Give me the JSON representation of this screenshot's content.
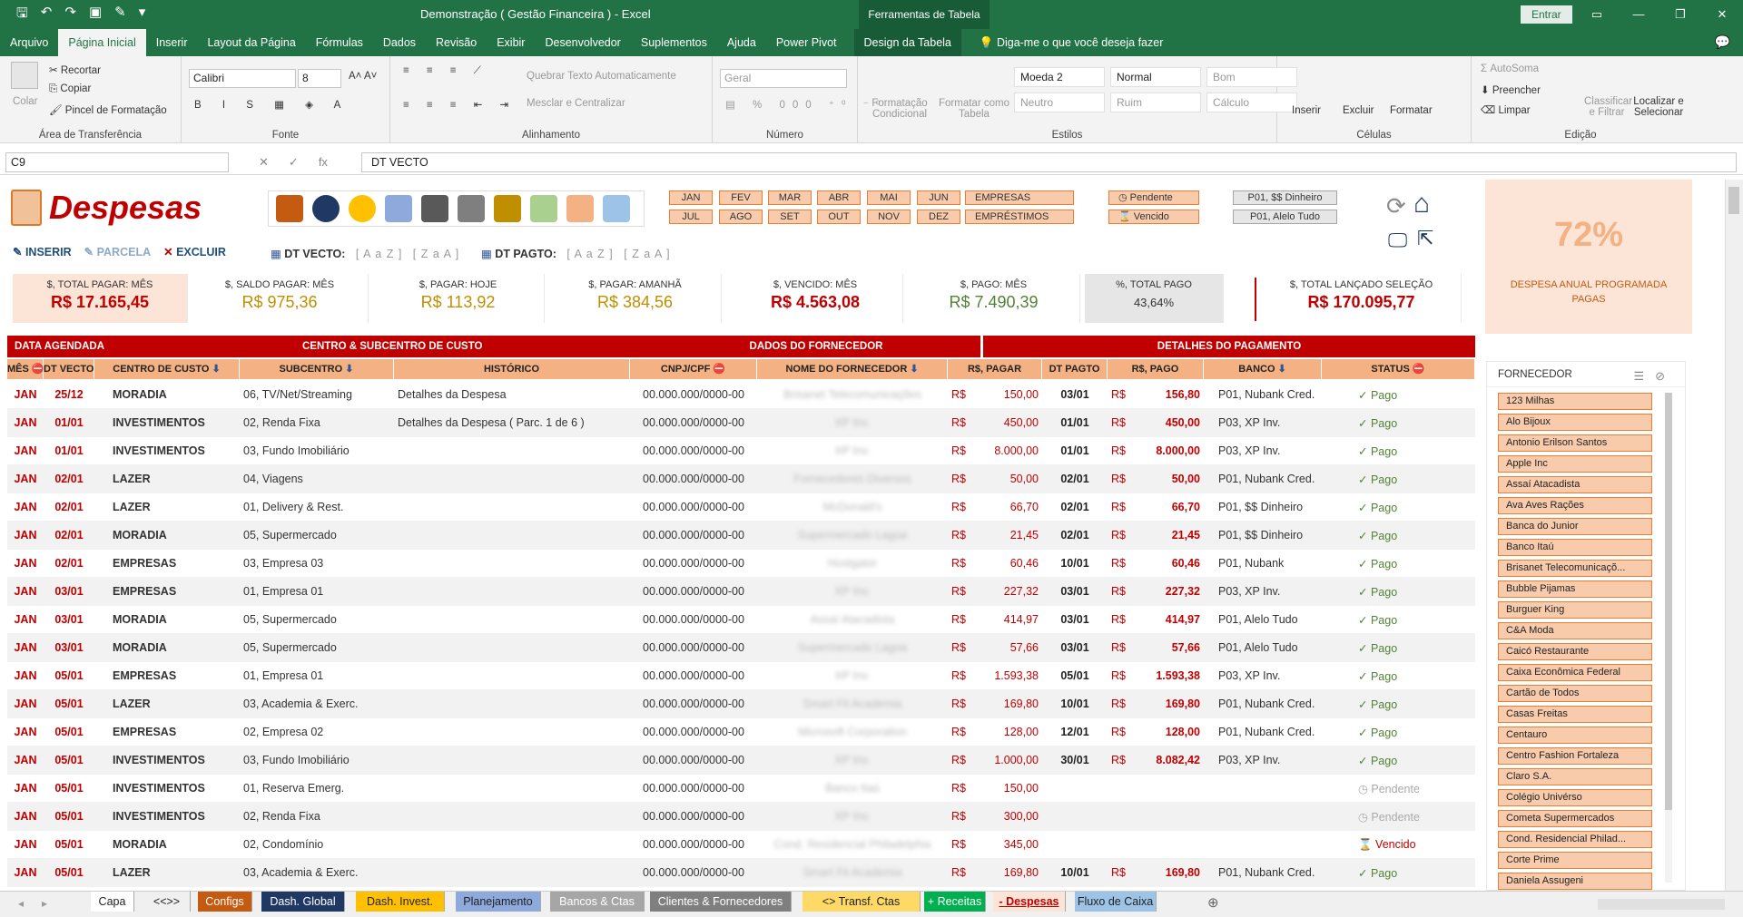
{
  "window": {
    "title": "Demonstração ( Gestão Financeira ) - Excel",
    "contextual": "Ferramentas de Tabela",
    "signin": "Entrar"
  },
  "ribbon_tabs": [
    "Arquivo",
    "Página Inicial",
    "Inserir",
    "Layout da Página",
    "Fórmulas",
    "Dados",
    "Revisão",
    "Exibir",
    "Desenvolvedor",
    "Suplementos",
    "Ajuda",
    "Power Pivot",
    "Design da Tabela"
  ],
  "tell_me": "Diga-me o que você deseja fazer",
  "ribbon": {
    "clipboard": {
      "paste": "Colar",
      "cut": "Recortar",
      "copy": "Copiar",
      "painter": "Pincel de Formatação",
      "label": "Área de Transferência"
    },
    "font": {
      "name": "Calibri",
      "size": "8",
      "label": "Fonte"
    },
    "alignment": {
      "wrap": "Quebrar Texto Automaticamente",
      "merge": "Mesclar e Centralizar",
      "label": "Alinhamento"
    },
    "number": {
      "format": "Geral",
      "label": "Número"
    },
    "styles": {
      "cond": "Formatação Condicional",
      "table": "Formatar como Tabela",
      "s1": "Moeda 2",
      "s2": "Normal",
      "s3": "Bom",
      "s4": "Neutro",
      "s5": "Ruim",
      "s6": "Cálculo",
      "label": "Estilos"
    },
    "cells": {
      "insert": "Inserir",
      "delete": "Excluir",
      "format": "Formatar",
      "label": "Células"
    },
    "editing": {
      "autosum": "AutoSoma",
      "fill": "Preencher",
      "clear": "Limpar",
      "sort": "Classificar e Filtrar",
      "find": "Localizar e Selecionar",
      "label": "Edição"
    }
  },
  "formula": {
    "cell": "C9",
    "content": "DT VECTO"
  },
  "sheet": {
    "title": "Despesas",
    "actions": {
      "insert": "INSERIR",
      "parcel": "PARCELA",
      "delete": "EXCLUIR"
    },
    "sort1": {
      "label": "DT VECTO:",
      "az": "[ A a Z ]",
      "za": "[ Z a A ]"
    },
    "sort2": {
      "label": "DT PAGTO:",
      "az": "[ A a Z ]",
      "za": "[ Z a A ]"
    },
    "months_top": [
      "JAN",
      "FEV",
      "MAR",
      "ABR",
      "MAI",
      "JUN"
    ],
    "months_bottom": [
      "JUL",
      "AGO",
      "SET",
      "OUT",
      "NOV",
      "DEZ"
    ],
    "wide_btns": [
      "EMPRESAS",
      "EMPRÉSTIMOS"
    ],
    "status_btns": [
      "Pendente",
      "Vencido"
    ],
    "bank_btns": [
      "P01, $$ Dinheiro",
      "P01, Alelo Tudo"
    ],
    "kpis": [
      {
        "label": "$, TOTAL PAGAR: MÊS",
        "value": "R$ 17.165,45"
      },
      {
        "label": "$, SALDO PAGAR: MÊS",
        "value": "R$ 975,36"
      },
      {
        "label": "$, PAGAR: HOJE",
        "value": "R$ 113,92"
      },
      {
        "label": "$, PAGAR: AMANHÃ",
        "value": "R$ 384,56"
      },
      {
        "label": "$, VENCIDO: MÊS",
        "value": "R$ 4.563,08"
      },
      {
        "label": "$, PAGO: MÊS",
        "value": "R$ 7.490,39"
      },
      {
        "label": "%, TOTAL PAGO",
        "value": "43,64%"
      },
      {
        "label": "$, TOTAL LANÇADO SELEÇÃO",
        "value": "R$ 170.095,77"
      }
    ],
    "side": {
      "pct": "72%",
      "caption1": "DESPESA ANUAL PROGRAMADA",
      "caption2": "PAGAS"
    },
    "sections": [
      "DATA AGENDADA",
      "CENTRO & SUBCENTRO DE CUSTO",
      "DADOS DO FORNECEDOR",
      "DETALHES DO PAGAMENTO"
    ],
    "columns": [
      "MÊS",
      "DT VECTO",
      "CENTRO DE CUSTO",
      "SUBCENTRO",
      "HISTÓRICO",
      "CNPJ/CPF",
      "NOME DO FORNECEDOR",
      "R$, PAGAR",
      "DT PAGTO",
      "R$, PAGO",
      "BANCO",
      "STATUS"
    ],
    "rows": [
      [
        "JAN",
        "25/12",
        "MORADIA",
        "06, TV/Net/Streaming",
        "Detalhes da Despesa",
        "00.000.000/0000-00",
        "Brisanet Telecomunicações",
        "150,00",
        "03/01",
        "156,80",
        "P01, Nubank Cred.",
        "✓ Pago"
      ],
      [
        "JAN",
        "01/01",
        "INVESTIMENTOS",
        "02, Renda Fixa",
        "Detalhes da Despesa ( Parc. 1 de 6 )",
        "00.000.000/0000-00",
        "XP Inv.",
        "450,00",
        "01/01",
        "450,00",
        "P03, XP Inv.",
        "✓ Pago"
      ],
      [
        "JAN",
        "01/01",
        "INVESTIMENTOS",
        "03, Fundo Imobiliário",
        "",
        "00.000.000/0000-00",
        "XP Inv.",
        "8.000,00",
        "01/01",
        "8.000,00",
        "P03, XP Inv.",
        "✓ Pago"
      ],
      [
        "JAN",
        "02/01",
        "LAZER",
        "04, Viagens",
        "",
        "00.000.000/0000-00",
        "Fornecedores Diversos",
        "50,00",
        "02/01",
        "50,00",
        "P01, Nubank Cred.",
        "✓ Pago"
      ],
      [
        "JAN",
        "02/01",
        "LAZER",
        "01, Delivery & Rest.",
        "",
        "00.000.000/0000-00",
        "McDonald's",
        "66,70",
        "02/01",
        "66,70",
        "P01, $$ Dinheiro",
        "✓ Pago"
      ],
      [
        "JAN",
        "02/01",
        "MORADIA",
        "05, Supermercado",
        "",
        "00.000.000/0000-00",
        "Supermercado Lagoa",
        "21,45",
        "02/01",
        "21,45",
        "P01, $$ Dinheiro",
        "✓ Pago"
      ],
      [
        "JAN",
        "02/01",
        "EMPRESAS",
        "03, Empresa 03",
        "",
        "00.000.000/0000-00",
        "Hostgator",
        "60,46",
        "10/01",
        "60,46",
        "P01, Nubank",
        "✓ Pago"
      ],
      [
        "JAN",
        "03/01",
        "EMPRESAS",
        "01, Empresa 01",
        "",
        "00.000.000/0000-00",
        "XP Inv.",
        "227,32",
        "03/01",
        "227,32",
        "P03, XP Inv.",
        "✓ Pago"
      ],
      [
        "JAN",
        "03/01",
        "MORADIA",
        "05, Supermercado",
        "",
        "00.000.000/0000-00",
        "Assaí Atacadista",
        "414,97",
        "03/01",
        "414,97",
        "P01, Alelo Tudo",
        "✓ Pago"
      ],
      [
        "JAN",
        "03/01",
        "MORADIA",
        "05, Supermercado",
        "",
        "00.000.000/0000-00",
        "Supermercado Lagoa",
        "57,66",
        "03/01",
        "57,66",
        "P01, Alelo Tudo",
        "✓ Pago"
      ],
      [
        "JAN",
        "05/01",
        "EMPRESAS",
        "01, Empresa 01",
        "",
        "00.000.000/0000-00",
        "XP Inv.",
        "1.593,38",
        "05/01",
        "1.593,38",
        "P03, XP Inv.",
        "✓ Pago"
      ],
      [
        "JAN",
        "05/01",
        "LAZER",
        "03, Academia & Exerc.",
        "",
        "00.000.000/0000-00",
        "Smart Fit Academia",
        "169,80",
        "10/01",
        "169,80",
        "P01, Nubank Cred.",
        "✓ Pago"
      ],
      [
        "JAN",
        "05/01",
        "EMPRESAS",
        "02, Empresa 02",
        "",
        "00.000.000/0000-00",
        "Microsoft Corporation",
        "128,00",
        "12/01",
        "128,00",
        "P01, Nubank Cred.",
        "✓ Pago"
      ],
      [
        "JAN",
        "05/01",
        "INVESTIMENTOS",
        "03, Fundo Imobiliário",
        "",
        "00.000.000/0000-00",
        "XP Inv.",
        "1.000,00",
        "30/01",
        "8.082,42",
        "P03, XP Inv.",
        "✓ Pago"
      ],
      [
        "JAN",
        "05/01",
        "INVESTIMENTOS",
        "01, Reserva Emerg.",
        "",
        "00.000.000/0000-00",
        "Banco Itaú",
        "150,00",
        "",
        "",
        "",
        "Pendente"
      ],
      [
        "JAN",
        "05/01",
        "INVESTIMENTOS",
        "02, Renda Fixa",
        "",
        "00.000.000/0000-00",
        "XP Inv.",
        "300,00",
        "",
        "",
        "",
        "Pendente"
      ],
      [
        "JAN",
        "05/01",
        "MORADIA",
        "02, Condomínio",
        "",
        "00.000.000/0000-00",
        "Cond. Residencial Philadelphia",
        "345,00",
        "",
        "",
        "",
        "Vencido"
      ],
      [
        "JAN",
        "05/01",
        "LAZER",
        "03, Academia & Exerc.",
        "",
        "00.000.000/0000-00",
        "Smart Fit Academia",
        "169,80",
        "10/01",
        "169,80",
        "P01, Nubank Cred.",
        "✓ Pago"
      ]
    ],
    "currency": "R$",
    "fornecedor": {
      "title": "FORNECEDOR",
      "items": [
        "123 Milhas",
        "Alo Bijoux",
        "Antonio Erilson Santos",
        "Apple Inc",
        "Assaí Atacadista",
        "Ava Aves Rações",
        "Banca do Junior",
        "Banco Itaú",
        "Brisanet Telecomunicaçõ...",
        "Bubble Pijamas",
        "Burguer King",
        "C&A Moda",
        "Caicó Restaurante",
        "Caixa Econômica Federal",
        "Cartão de Todos",
        "Casas Freitas",
        "Centauro",
        "Centro Fashion Fortaleza",
        "Claro S.A.",
        "Colégio Univérso",
        "Cometa Supermercados",
        "Cond. Residencial Philad...",
        "Corte Prime",
        "Daniela Assugeni"
      ]
    }
  },
  "sheet_tabs": [
    {
      "name": "Capa",
      "bg": "#ffffff",
      "fg": "#222"
    },
    {
      "name": "<<>>",
      "bg": "#f0f0f0",
      "fg": "#222"
    },
    {
      "name": "Configs",
      "bg": "#c55a11",
      "fg": "#ffffff"
    },
    {
      "name": "Dash. Global",
      "bg": "#1f3864",
      "fg": "#ffffff"
    },
    {
      "name": "Dash. Invest.",
      "bg": "#ffc000",
      "fg": "#222"
    },
    {
      "name": "Planejamento",
      "bg": "#8ea9db",
      "fg": "#222"
    },
    {
      "name": "Bancos & Ctas",
      "bg": "#a6a6a6",
      "fg": "#ffffff"
    },
    {
      "name": "Clientes & Fornecedores",
      "bg": "#7f7f7f",
      "fg": "#ffffff"
    },
    {
      "name": "<> Transf. Ctas",
      "bg": "#ffd966",
      "fg": "#222"
    },
    {
      "name": "+ Receitas",
      "bg": "#00b050",
      "fg": "#ffffff"
    },
    {
      "name": "- Despesas",
      "bg": "#fce4d6",
      "fg": "#c00000"
    },
    {
      "name": "Fluxo de Caixa",
      "bg": "#9dc3e6",
      "fg": "#222"
    }
  ]
}
